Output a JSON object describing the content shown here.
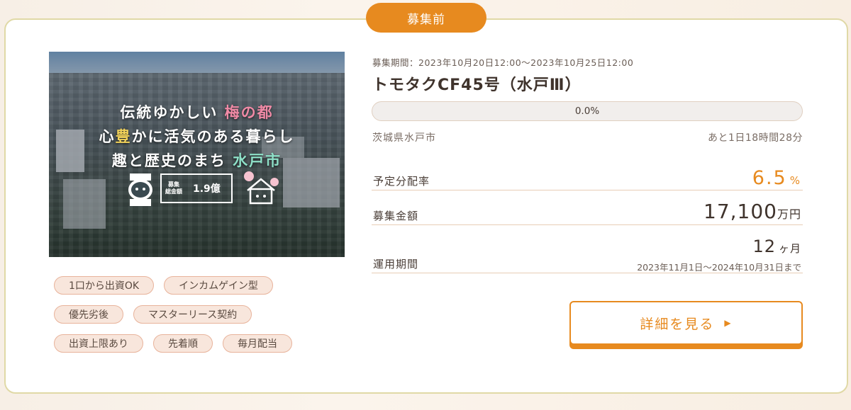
{
  "status": "募集前",
  "banner": {
    "line1_a": "伝統ゆかしい",
    "line1_b": "梅の都",
    "line2_a": "心",
    "line2_b": "豊",
    "line2_c": "かに活気のある暮らし",
    "line3_a": "趣と歴史のまち",
    "line3_b": "水戸市",
    "badge_small": "募集\n総金額",
    "badge_big": "1.9億"
  },
  "tags": [
    [
      "1口から出資OK",
      "インカムゲイン型"
    ],
    [
      "優先劣後",
      "マスターリース契約"
    ],
    [
      "出資上限あり",
      "先着順",
      "毎月配当"
    ]
  ],
  "offering": {
    "period": "募集期間：2023年10月20日12:00～2023年10月25日12:00",
    "title": "トモタクCF45号（水戸Ⅲ）",
    "progress": "0.0%",
    "location": "茨城県水戸市",
    "remaining": "あと1日18時間28分"
  },
  "stats": {
    "rate_label": "予定分配率",
    "rate_value": "6.5",
    "rate_unit": "%",
    "amount_label": "募集金額",
    "amount_value": "17,100",
    "amount_unit": "万円",
    "term_label": "運用期間",
    "term_value": "12",
    "term_unit": "ヶ月",
    "term_range": "2023年11月1日～2024年10月31日まで"
  },
  "detail_button": "詳細を見る",
  "colors": {
    "accent": "#e78a1f",
    "tag_bg": "#f8e6dc",
    "border": "#e0d9a6"
  }
}
